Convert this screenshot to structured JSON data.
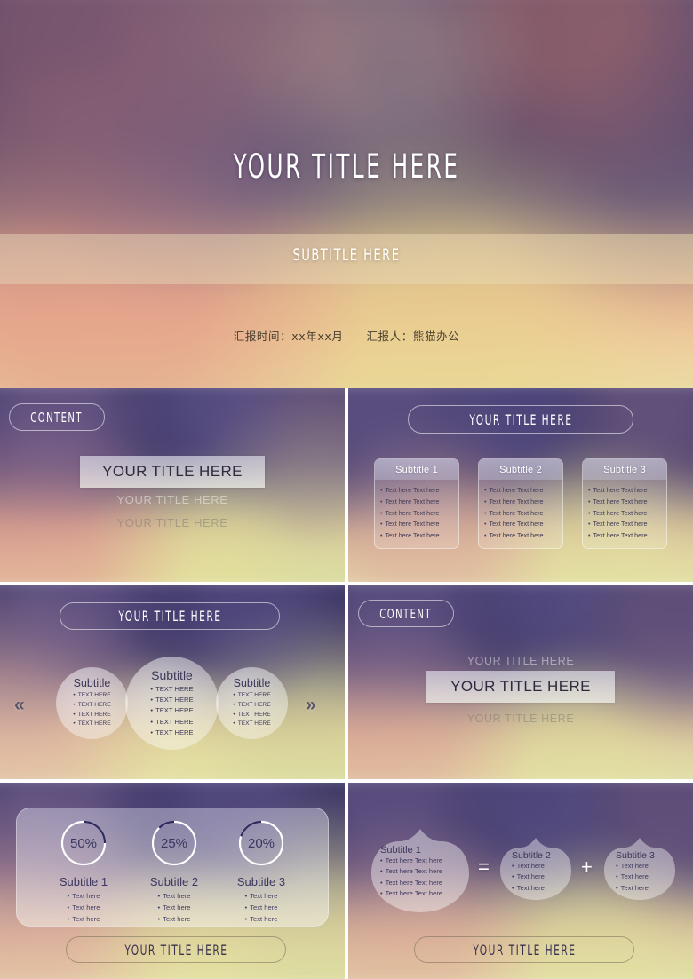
{
  "colors": {
    "accent_navy": "#2f2a5e",
    "text_dark": "#3b3658",
    "title_white": "#ffffff",
    "band_warm": "#e4d0b6"
  },
  "banner": {
    "title": "YOUR TITLE HERE",
    "subtitle": "SUBTITLE HERE",
    "meta_date_label": "汇报时间：",
    "meta_date_value": "xx年xx月",
    "meta_author_label": "汇报人：",
    "meta_author_value": "熊猫办公"
  },
  "slides": [
    {
      "id": "section-divider-1",
      "badge": "CONTENT",
      "main_title": "YOUR TITLE HERE",
      "ghost_title_1": "YOUR TITLE HERE",
      "ghost_title_2": "YOUR TITLE HERE"
    },
    {
      "id": "three-column-list",
      "title": "YOUR TITLE HERE",
      "columns": [
        {
          "head": "Subtitle 1",
          "items": [
            "Text here Text here",
            "Text here Text here",
            "Text here Text here",
            "Text here Text here",
            "Text here Text here"
          ]
        },
        {
          "head": "Subtitle 2",
          "items": [
            "Text here Text here",
            "Text here Text here",
            "Text here Text here",
            "Text here Text here",
            "Text here Text here"
          ]
        },
        {
          "head": "Subtitle 3",
          "items": [
            "Text here Text here",
            "Text here Text here",
            "Text here Text here",
            "Text here Text here",
            "Text here Text here"
          ]
        }
      ]
    },
    {
      "id": "three-circle-diagram",
      "title": "YOUR TITLE HERE",
      "prev_icon": "«",
      "next_icon": "»",
      "circles": [
        {
          "head": "Subtitle",
          "items": [
            "TEXT HERE",
            "TEXT HERE",
            "TEXT HERE",
            "TEXT HERE"
          ]
        },
        {
          "head": "Subtitle",
          "items": [
            "TEXT HERE",
            "TEXT HERE",
            "TEXT HERE",
            "TEXT HERE",
            "TEXT HERE"
          ]
        },
        {
          "head": "Subtitle",
          "items": [
            "TEXT HERE",
            "TEXT HERE",
            "TEXT HERE",
            "TEXT HERE"
          ]
        }
      ]
    },
    {
      "id": "section-divider-2",
      "badge": "CONTENT",
      "ghost_title_1": "YOUR TITLE HERE",
      "main_title": "YOUR TITLE HERE",
      "ghost_title_2": "YOUR TITLE HERE"
    },
    {
      "id": "percentage-donuts",
      "footer_title": "YOUR TITLE HERE",
      "stats": [
        {
          "percent": "50%",
          "value": 50,
          "head": "Subtitle 1",
          "items": [
            "Text here",
            "Text here",
            "Text here"
          ]
        },
        {
          "percent": "25%",
          "value": 25,
          "head": "Subtitle 2",
          "items": [
            "Text here",
            "Text here",
            "Text here"
          ]
        },
        {
          "percent": "20%",
          "value": 20,
          "head": "Subtitle 3",
          "items": [
            "Text here",
            "Text here",
            "Text here"
          ]
        }
      ]
    },
    {
      "id": "equation-leaves",
      "footer_title": "YOUR TITLE HERE",
      "operator_equals": "=",
      "operator_plus": "+",
      "leaves": [
        {
          "head": "Subtitle 1",
          "items": [
            "Text here Text here",
            "Text here Text here",
            "Text here Text here",
            "Text here Text here"
          ]
        },
        {
          "head": "Subtitle 2",
          "items": [
            "Text here",
            "Text here",
            "Text here"
          ]
        },
        {
          "head": "Subtitle 3",
          "items": [
            "Text here",
            "Text here",
            "Text here"
          ]
        }
      ]
    }
  ],
  "chart_data": {
    "type": "pie",
    "title": "Percentage donut indicators",
    "categories": [
      "Subtitle 1",
      "Subtitle 2",
      "Subtitle 3"
    ],
    "values": [
      50,
      25,
      20
    ],
    "labels": [
      "50%",
      "25%",
      "20%"
    ],
    "ylim": [
      0,
      100
    ]
  }
}
